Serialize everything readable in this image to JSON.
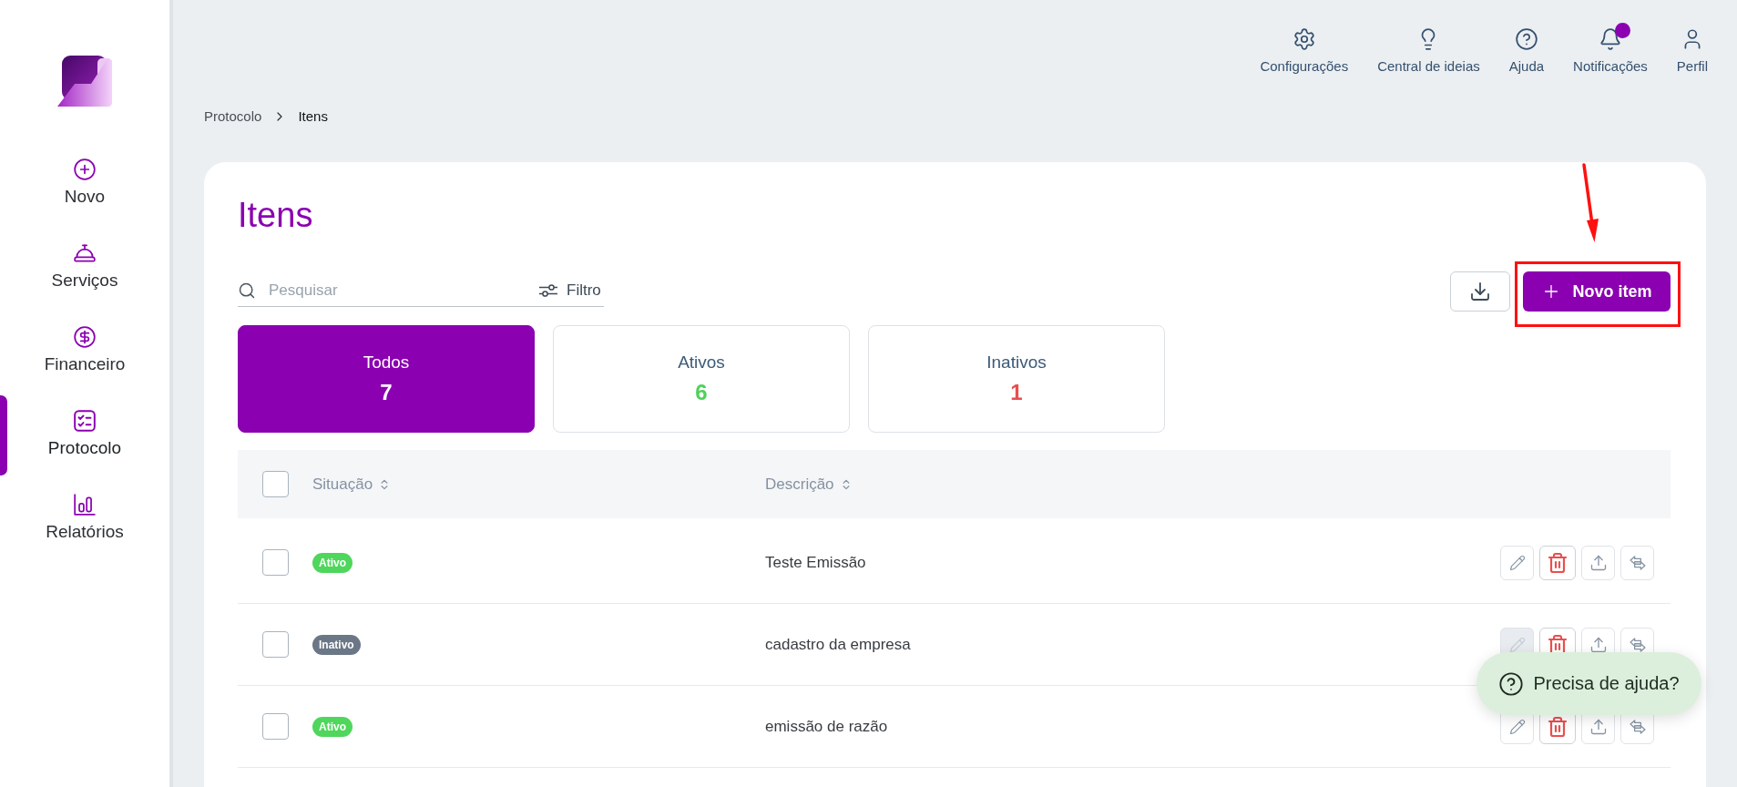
{
  "sidebar": {
    "items": [
      {
        "kind": "new",
        "label": "Novo",
        "selected": false
      },
      {
        "kind": "services",
        "label": "Serviços",
        "selected": false
      },
      {
        "kind": "finance",
        "label": "Financeiro",
        "selected": false
      },
      {
        "kind": "protocol",
        "label": "Protocolo",
        "selected": true
      },
      {
        "kind": "reports",
        "label": "Relatórios",
        "selected": false
      }
    ]
  },
  "topbar": {
    "items": [
      {
        "kind": "settings",
        "label": "Configurações",
        "unread": false
      },
      {
        "kind": "ideas",
        "label": "Central de ideias",
        "unread": false
      },
      {
        "kind": "help",
        "label": "Ajuda",
        "unread": false
      },
      {
        "kind": "notifications",
        "label": "Notificações",
        "unread": true
      },
      {
        "kind": "profile",
        "label": "Perfil",
        "unread": false
      }
    ]
  },
  "breadcrumb": [
    "Protocolo",
    "Itens"
  ],
  "page": {
    "title": "Itens"
  },
  "search": {
    "placeholder": "Pesquisar"
  },
  "filter_button": "Filtro",
  "new_button": "Novo item",
  "tabs": [
    {
      "kind": "all",
      "label": "Todos",
      "count": "7",
      "selected": true
    },
    {
      "kind": "active",
      "label": "Ativos",
      "count": "6",
      "selected": false
    },
    {
      "kind": "inactive",
      "label": "Inativos",
      "count": "1",
      "selected": false
    }
  ],
  "table": {
    "select_all": {
      "checked": false
    },
    "columns": [
      "Situação",
      "Descrição"
    ],
    "rows": [
      {
        "checked": false,
        "status": {
          "label": "Ativo",
          "color": "#4fd65c"
        },
        "description": "Teste Emissão",
        "actions": [
          {
            "kind": "edit",
            "disabled": false
          },
          {
            "kind": "delete",
            "disabled": false
          },
          {
            "kind": "upload",
            "disabled": false
          },
          {
            "kind": "swap",
            "disabled": false
          }
        ]
      },
      {
        "checked": false,
        "status": {
          "label": "Inativo",
          "color": "#6b7787"
        },
        "description": "cadastro da empresa",
        "actions": [
          {
            "kind": "edit",
            "disabled": true
          },
          {
            "kind": "delete",
            "disabled": false
          },
          {
            "kind": "upload",
            "disabled": false
          },
          {
            "kind": "swap",
            "disabled": false
          }
        ]
      },
      {
        "checked": false,
        "status": {
          "label": "Ativo",
          "color": "#4fd65c"
        },
        "description": "emissão de razão",
        "actions": [
          {
            "kind": "edit",
            "disabled": false
          },
          {
            "kind": "delete",
            "disabled": false
          },
          {
            "kind": "upload",
            "disabled": false
          },
          {
            "kind": "swap",
            "disabled": false
          }
        ]
      }
    ]
  },
  "help_button": "Precisa de ajuda?"
}
